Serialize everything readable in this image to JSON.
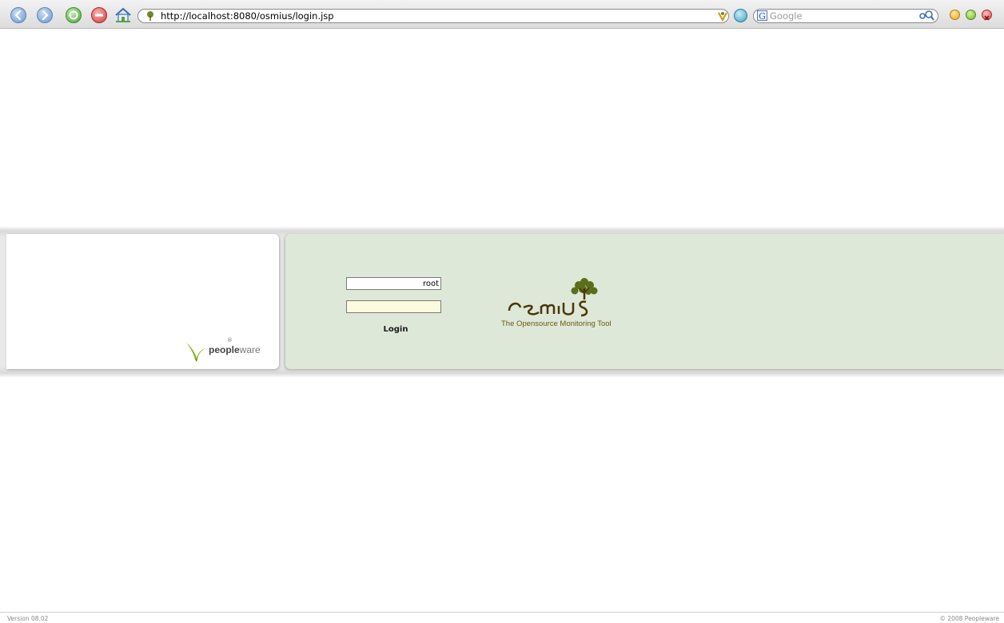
{
  "browser": {
    "url": "http://localhost:8080/osmius/login.jsp",
    "search_placeholder": "Google",
    "search_engine_letter": "G"
  },
  "login": {
    "username_value": "root",
    "password_value": "",
    "button_label": "Login"
  },
  "branding": {
    "partner_logo_text_bold": "people",
    "partner_logo_text_light": "ware",
    "partner_logo_mark": "®",
    "product_logo_text": "Osmius",
    "product_tagline": "The Opensource Monitoring Tool"
  },
  "footer": {
    "version": "Version 08.02",
    "copyright": "© 2008 Peopleware"
  },
  "colors": {
    "login_panel_bg": "#dee8d8",
    "password_field_bg": "#fbfbde",
    "osmius_brown": "#4a3606",
    "tree_green": "#5b6e1a"
  }
}
